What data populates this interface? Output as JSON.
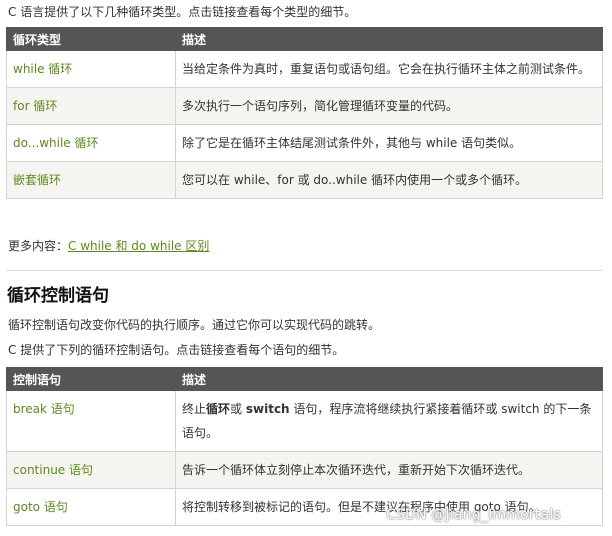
{
  "intro": "C 语言提供了以下几种循环类型。点击链接查看每个类型的细节。",
  "loop_table": {
    "headers": [
      "循环类型",
      "描述"
    ],
    "rows": [
      {
        "name": "while 循环",
        "desc": "当给定条件为真时，重复语句或语句组。它会在执行循环主体之前测试条件。"
      },
      {
        "name": "for 循环",
        "desc": "多次执行一个语句序列，简化管理循环变量的代码。"
      },
      {
        "name": "do...while 循环",
        "desc": "除了它是在循环主体结尾测试条件外，其他与 while 语句类似。"
      },
      {
        "name": "嵌套循环",
        "desc": "您可以在 while、for 或 do..while 循环内使用一个或多个循环。"
      }
    ]
  },
  "more": {
    "label": "更多内容：",
    "link": "C while 和 do while 区别"
  },
  "control_section": {
    "title": "循环控制语句",
    "para1": "循环控制语句改变你代码的执行顺序。通过它你可以实现代码的跳转。",
    "para2": "C 提供了下列的循环控制语句。点击链接查看每个语句的细节。"
  },
  "control_table": {
    "headers": [
      "控制语句",
      "描述"
    ],
    "rows": [
      {
        "name": "break 语句",
        "desc_pre": "终止",
        "desc_b1": "循环",
        "desc_mid": "或 ",
        "desc_b2": "switch",
        "desc_post": " 语句，程序流将继续执行紧接着循环或 switch 的下一条语句。"
      },
      {
        "name": "continue 语句",
        "desc": "告诉一个循环体立刻停止本次循环迭代，重新开始下次循环迭代。"
      },
      {
        "name": "goto 语句",
        "desc": "将控制转移到被标记的语句。但是不建议在程序中使用 goto 语句。"
      }
    ]
  },
  "watermark": "CSDN @Jiang_Immortals"
}
